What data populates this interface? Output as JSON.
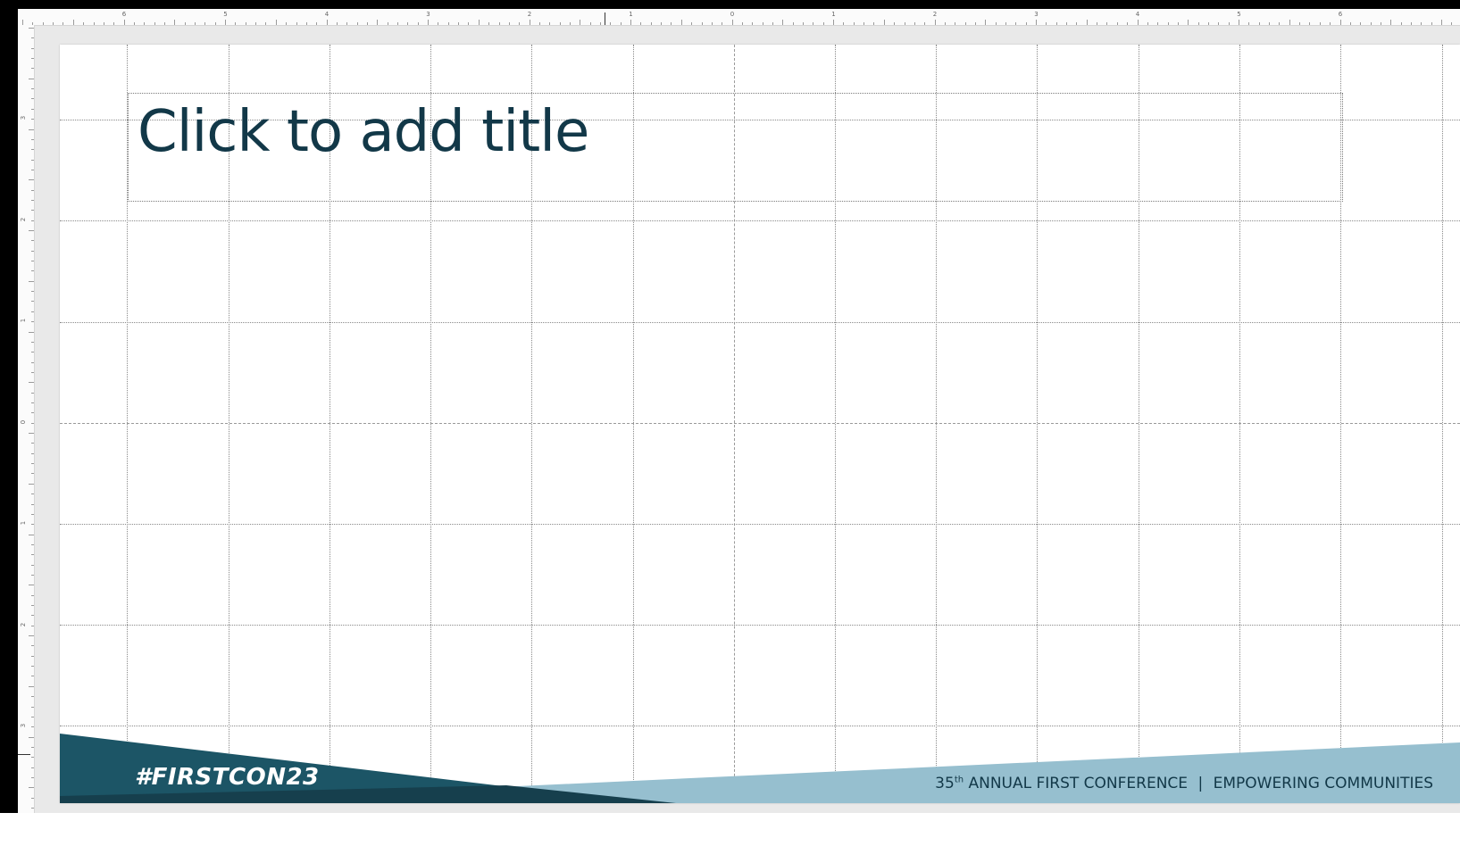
{
  "rulers": {
    "horizontal_labels": [
      "6",
      "5",
      "4",
      "3",
      "2",
      "1",
      "0",
      "1",
      "2",
      "3",
      "4",
      "5",
      "6"
    ],
    "vertical_labels": [
      "3",
      "2",
      "1",
      "0",
      "1",
      "2",
      "3"
    ]
  },
  "slide": {
    "title_placeholder": "Click to add title",
    "footer": {
      "hashtag": "#FIRSTCON23",
      "edition": "35",
      "edition_suffix": "th",
      "conference_name": "ANNUAL FIRST CONFERENCE",
      "separator": "|",
      "tagline": "EMPOWERING COMMUNITIES"
    }
  },
  "colors": {
    "dark_teal": "#1c5566",
    "navy": "#123848",
    "light_blue": "#96bfcf",
    "title_text": "#123848"
  }
}
